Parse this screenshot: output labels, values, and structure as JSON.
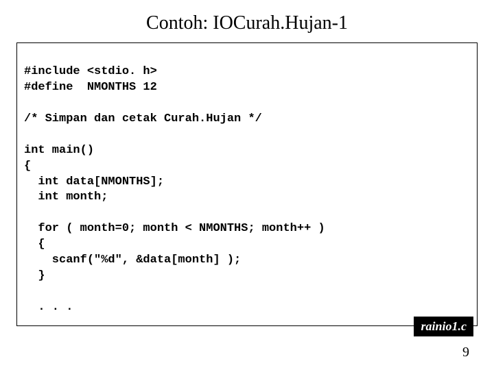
{
  "title": "Contoh: IOCurah.Hujan-1",
  "code": {
    "line1": "#include <stdio. h>",
    "line2": "#define  NMONTHS 12",
    "line3": "",
    "line4": "/* Simpan dan cetak Curah.Hujan */",
    "line5": "",
    "line6": "int main()",
    "line7": "{",
    "line8": "  int data[NMONTHS];",
    "line9": "  int month;",
    "line10": "",
    "line11": "  for ( month=0; month < NMONTHS; month++ )",
    "line12": "  {",
    "line13": "    scanf(\"%d\", &data[month] );",
    "line14": "  }",
    "line15": "",
    "line16": "  . . ."
  },
  "file_label": "rainio1.c",
  "page_number": "9"
}
